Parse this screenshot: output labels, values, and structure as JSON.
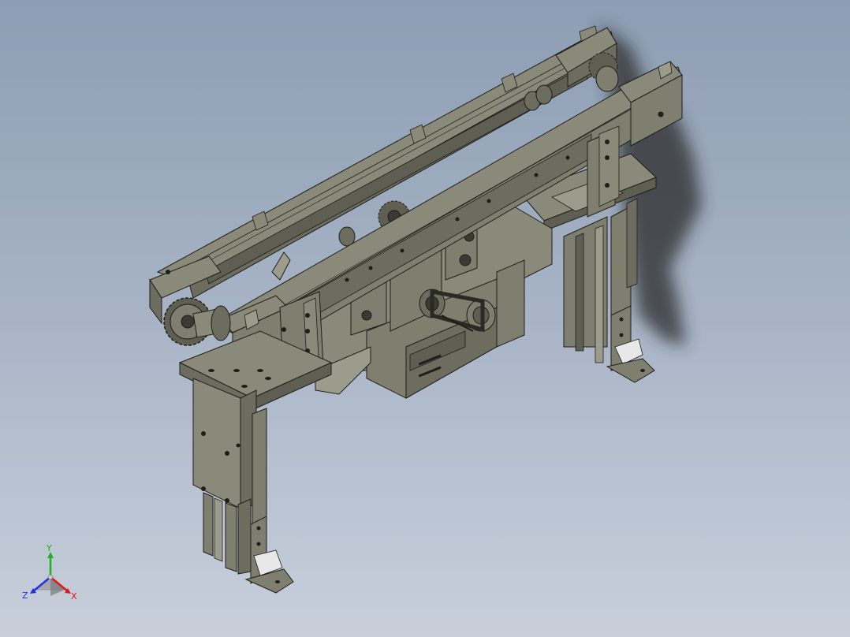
{
  "viewport": {
    "background_top": "#8d9db3",
    "background_bottom": "#c8cfdb"
  },
  "model": {
    "body_color": "#7f7f70",
    "light_face_color": "#9c9c8c",
    "dark_face_color": "#5e5e52",
    "edge_color": "#1e1e1a",
    "shadow_color": "#2a2a2a"
  },
  "triad": {
    "labels": {
      "x": "X",
      "y": "Y",
      "z": "Z"
    },
    "colors": {
      "x": "#e01818",
      "y": "#20b020",
      "z": "#2030e0"
    }
  }
}
